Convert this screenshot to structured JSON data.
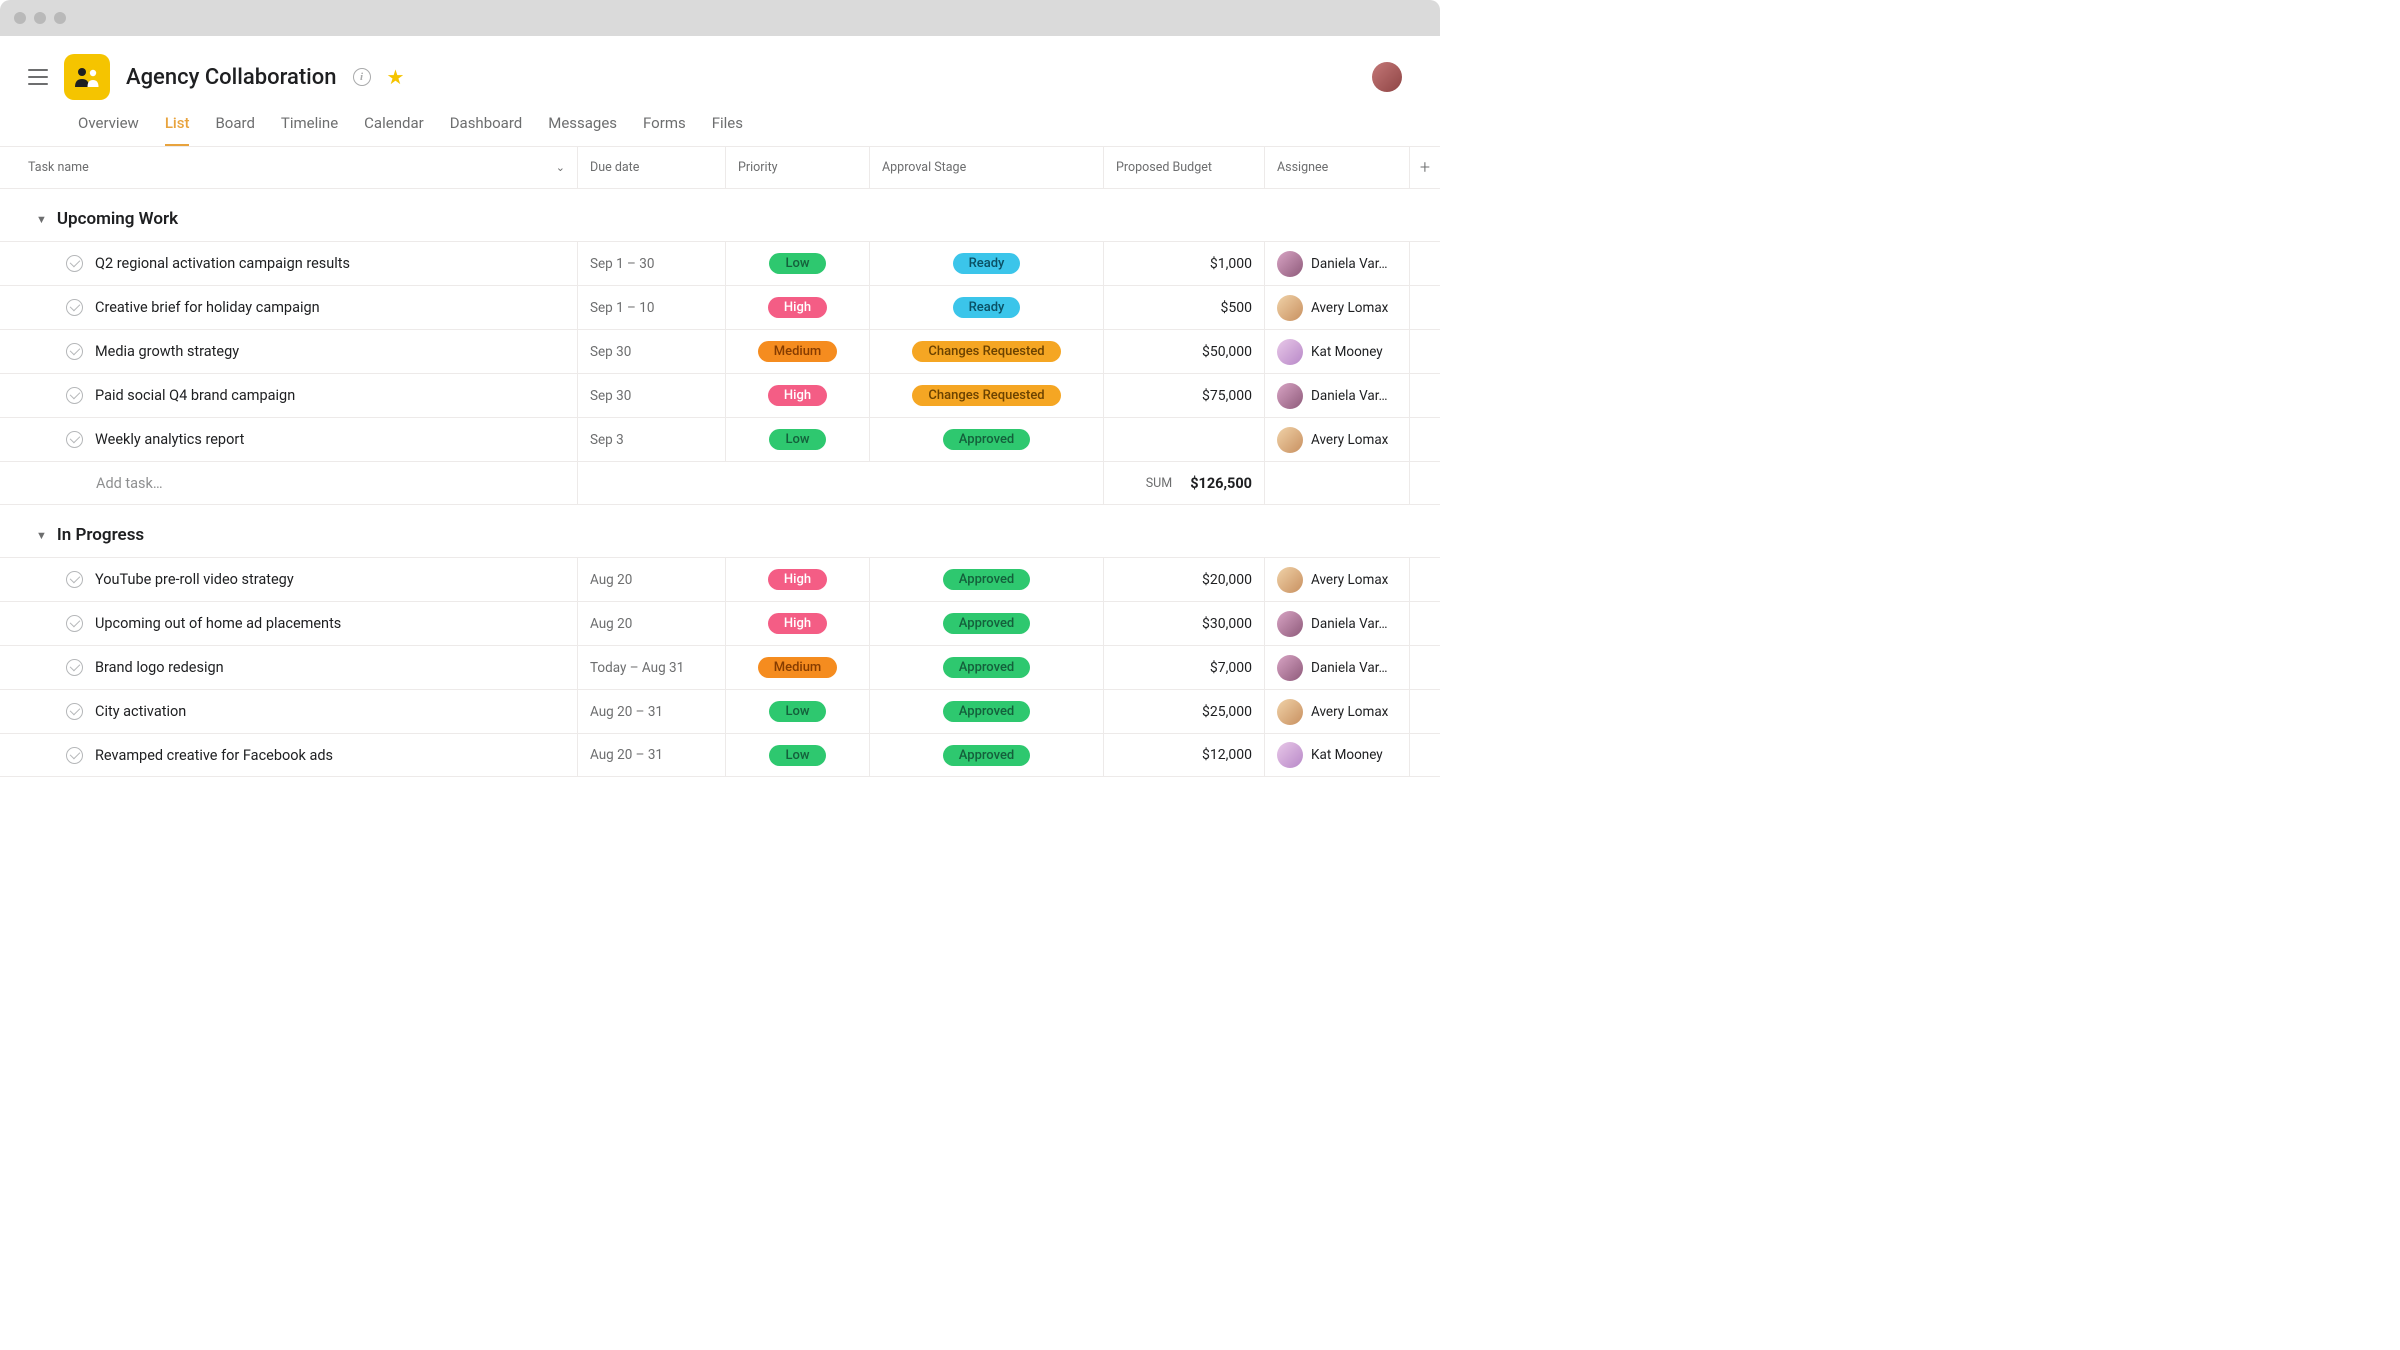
{
  "project": {
    "title": "Agency Collaboration"
  },
  "tabs": [
    "Overview",
    "List",
    "Board",
    "Timeline",
    "Calendar",
    "Dashboard",
    "Messages",
    "Forms",
    "Files"
  ],
  "active_tab": "List",
  "columns": {
    "task": "Task name",
    "due": "Due date",
    "priority": "Priority",
    "approval": "Approval Stage",
    "budget": "Proposed Budget",
    "assignee": "Assignee"
  },
  "sections": [
    {
      "title": "Upcoming Work",
      "tasks": [
        {
          "name": "Q2 regional activation campaign results",
          "due": "Sep 1 – 30",
          "priority": "Low",
          "approval": "Ready",
          "budget": "$1,000",
          "assignee": "Daniela Var…",
          "avatar": "daniela"
        },
        {
          "name": "Creative brief for holiday campaign",
          "due": "Sep 1 – 10",
          "priority": "High",
          "approval": "Ready",
          "budget": "$500",
          "assignee": "Avery Lomax",
          "avatar": "avery"
        },
        {
          "name": "Media growth strategy",
          "due": "Sep 30",
          "priority": "Medium",
          "approval": "Changes Requested",
          "budget": "$50,000",
          "assignee": "Kat Mooney",
          "avatar": "kat"
        },
        {
          "name": "Paid social Q4 brand campaign",
          "due": "Sep 30",
          "priority": "High",
          "approval": "Changes Requested",
          "budget": "$75,000",
          "assignee": "Daniela Var…",
          "avatar": "daniela"
        },
        {
          "name": "Weekly analytics report",
          "due": "Sep 3",
          "priority": "Low",
          "approval": "Approved",
          "budget": "",
          "assignee": "Avery Lomax",
          "avatar": "avery"
        }
      ],
      "add_task": "Add task…",
      "sum_label": "SUM",
      "sum_value": "$126,500"
    },
    {
      "title": "In Progress",
      "tasks": [
        {
          "name": "YouTube pre-roll video strategy",
          "due": "Aug 20",
          "priority": "High",
          "approval": "Approved",
          "budget": "$20,000",
          "assignee": "Avery Lomax",
          "avatar": "avery"
        },
        {
          "name": "Upcoming out of home ad placements",
          "due": "Aug 20",
          "priority": "High",
          "approval": "Approved",
          "budget": "$30,000",
          "assignee": "Daniela Var…",
          "avatar": "daniela"
        },
        {
          "name": "Brand logo redesign",
          "due": "Today – Aug 31",
          "priority": "Medium",
          "approval": "Approved",
          "budget": "$7,000",
          "assignee": "Daniela Var…",
          "avatar": "daniela"
        },
        {
          "name": "City activation",
          "due": "Aug 20 – 31",
          "priority": "Low",
          "approval": "Approved",
          "budget": "$25,000",
          "assignee": "Avery Lomax",
          "avatar": "avery"
        },
        {
          "name": "Revamped creative for Facebook ads",
          "due": "Aug 20 – 31",
          "priority": "Low",
          "approval": "Approved",
          "budget": "$12,000",
          "assignee": "Kat Mooney",
          "avatar": "kat"
        }
      ]
    }
  ]
}
